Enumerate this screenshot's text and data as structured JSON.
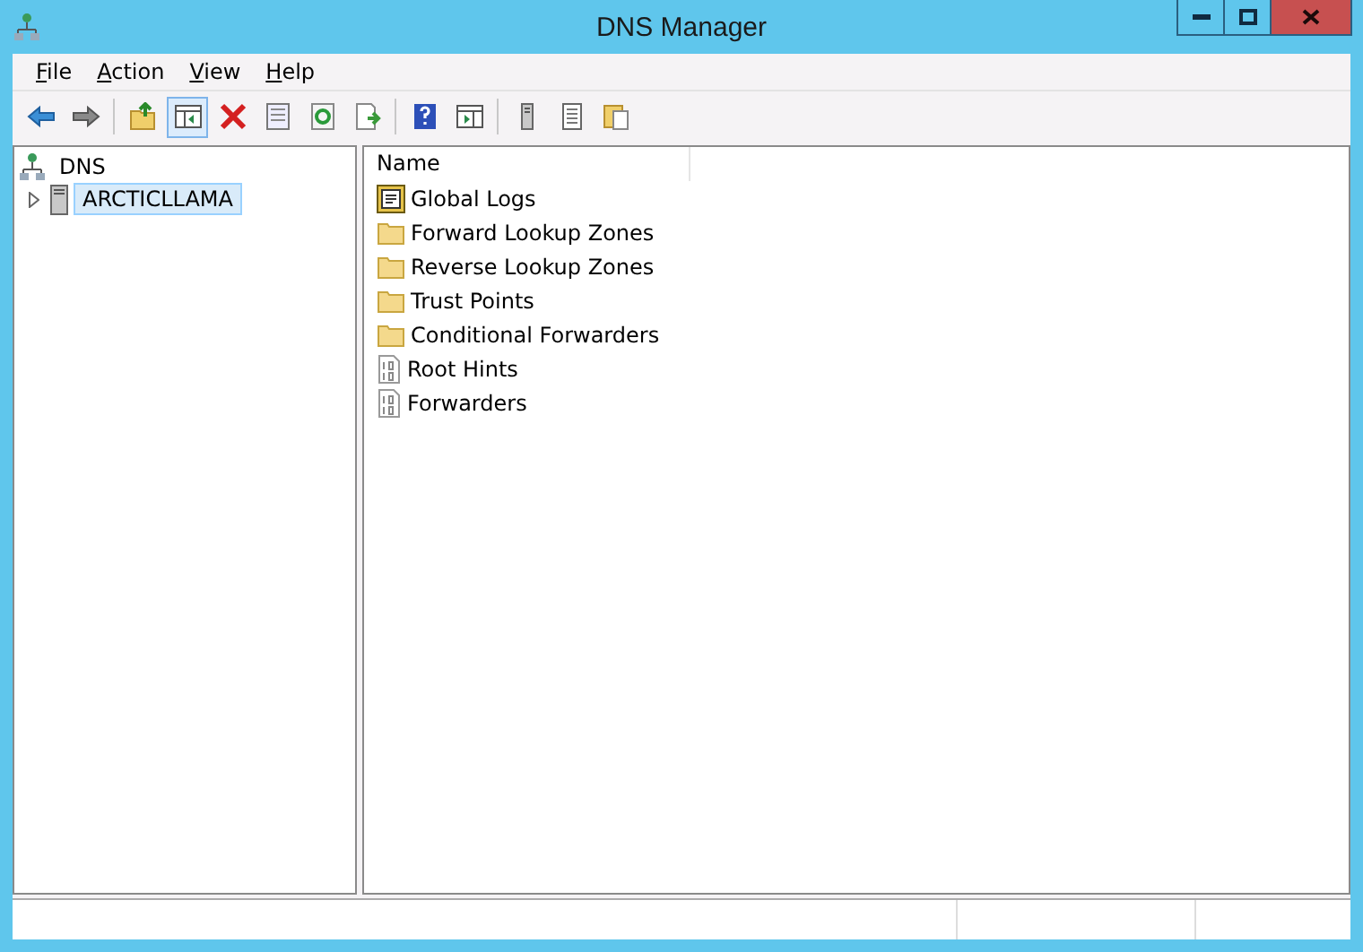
{
  "window": {
    "title": "DNS Manager"
  },
  "menu": [
    "File",
    "Action",
    "View",
    "Help"
  ],
  "toolbar": [
    {
      "kind": "back",
      "selected": false
    },
    {
      "kind": "forward",
      "selected": false
    },
    {
      "kind": "sep"
    },
    {
      "kind": "up",
      "selected": false
    },
    {
      "kind": "tree",
      "selected": true
    },
    {
      "kind": "delete",
      "selected": false
    },
    {
      "kind": "properties",
      "selected": false
    },
    {
      "kind": "refresh",
      "selected": false
    },
    {
      "kind": "export",
      "selected": false
    },
    {
      "kind": "sep"
    },
    {
      "kind": "help",
      "selected": false
    },
    {
      "kind": "actionpane",
      "selected": false
    },
    {
      "kind": "sep"
    },
    {
      "kind": "server",
      "selected": false
    },
    {
      "kind": "list",
      "selected": false
    },
    {
      "kind": "clipboard",
      "selected": false
    }
  ],
  "tree": [
    {
      "label": "DNS",
      "kind": "dns",
      "selected": false,
      "children": [
        {
          "label": "ARCTICLLAMA",
          "kind": "server",
          "selected": true,
          "expanded": false
        }
      ]
    }
  ],
  "list": {
    "columns": [
      "Name"
    ],
    "rows": [
      {
        "name": "Global Logs",
        "kind": "log"
      },
      {
        "name": "Forward Lookup Zones",
        "kind": "folder"
      },
      {
        "name": "Reverse Lookup Zones",
        "kind": "folder"
      },
      {
        "name": "Trust Points",
        "kind": "folder"
      },
      {
        "name": "Conditional Forwarders",
        "kind": "folder"
      },
      {
        "name": "Root Hints",
        "kind": "file"
      },
      {
        "name": "Forwarders",
        "kind": "file"
      }
    ]
  }
}
